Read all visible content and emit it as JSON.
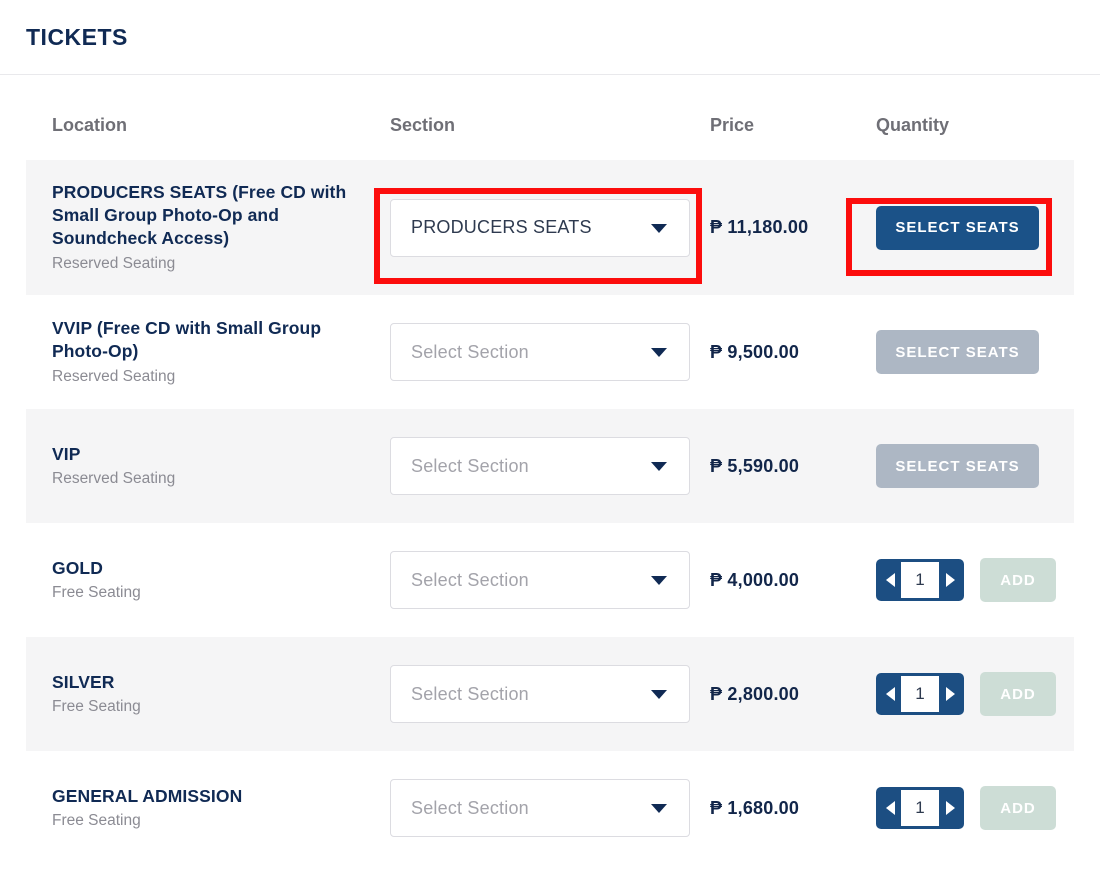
{
  "header": {
    "title": "TICKETS"
  },
  "columns": {
    "location": "Location",
    "section": "Section",
    "price": "Price",
    "quantity": "Quantity"
  },
  "labels": {
    "select_seats": "SELECT SEATS",
    "add": "ADD",
    "section_placeholder": "Select Section",
    "prev_icon": "triangle-left-icon",
    "next_icon": "triangle-right-icon",
    "chevron_icon": "chevron-down-icon"
  },
  "colors": {
    "brand_navy": "#102a54",
    "button_blue": "#1b5288",
    "button_disabled": "#adb7c4",
    "add_button": "#cdddd6",
    "stripe": "#f5f5f6",
    "highlight": "#fc0d0d",
    "muted_text": "#8b8b93"
  },
  "rows": [
    {
      "name": "PRODUCERS SEATS (Free CD with Small Group Photo-Op and Soundcheck Access)",
      "seating": "Reserved Seating",
      "section_value": "PRODUCERS SEATS",
      "section_selected": true,
      "price": "₱ 11,180.00",
      "action": "select-seats",
      "action_label": "SELECT SEATS",
      "action_enabled": true,
      "striped": true,
      "highlighted": true
    },
    {
      "name": "VVIP (Free CD with Small Group Photo-Op)",
      "seating": "Reserved Seating",
      "section_value": "Select Section",
      "section_selected": false,
      "price": "₱ 9,500.00",
      "action": "select-seats",
      "action_label": "SELECT SEATS",
      "action_enabled": false,
      "striped": false,
      "highlighted": false
    },
    {
      "name": "VIP",
      "seating": "Reserved Seating",
      "section_value": "Select Section",
      "section_selected": false,
      "price": "₱ 5,590.00",
      "action": "select-seats",
      "action_label": "SELECT SEATS",
      "action_enabled": false,
      "striped": true,
      "highlighted": false
    },
    {
      "name": "GOLD",
      "seating": "Free Seating",
      "section_value": "Select Section",
      "section_selected": false,
      "price": "₱ 4,000.00",
      "action": "stepper",
      "action_label": "ADD",
      "quantity": "1",
      "action_enabled": true,
      "striped": false,
      "highlighted": false
    },
    {
      "name": "SILVER",
      "seating": "Free Seating",
      "section_value": "Select Section",
      "section_selected": false,
      "price": "₱ 2,800.00",
      "action": "stepper",
      "action_label": "ADD",
      "quantity": "1",
      "action_enabled": true,
      "striped": true,
      "highlighted": false
    },
    {
      "name": "GENERAL ADMISSION",
      "seating": "Free Seating",
      "section_value": "Select Section",
      "section_selected": false,
      "price": "₱ 1,680.00",
      "action": "stepper",
      "action_label": "ADD",
      "quantity": "1",
      "action_enabled": true,
      "striped": false,
      "highlighted": false
    }
  ]
}
